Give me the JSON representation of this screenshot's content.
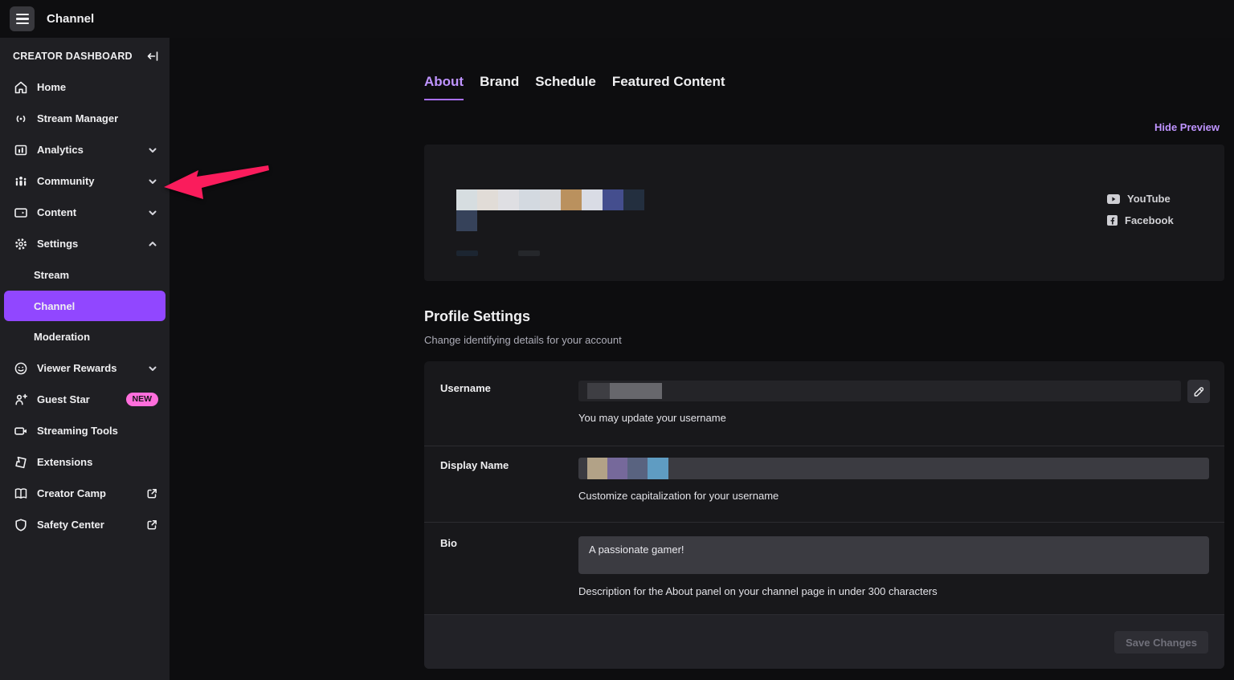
{
  "topbar": {
    "title": "Channel"
  },
  "sidebar": {
    "header": "CREATOR DASHBOARD",
    "items": [
      {
        "label": "Home",
        "icon": "home-icon"
      },
      {
        "label": "Stream Manager",
        "icon": "broadcast-icon"
      },
      {
        "label": "Analytics",
        "icon": "analytics-icon",
        "chevron": "down"
      },
      {
        "label": "Community",
        "icon": "community-icon",
        "chevron": "down"
      },
      {
        "label": "Content",
        "icon": "content-icon",
        "chevron": "down"
      },
      {
        "label": "Settings",
        "icon": "gear-icon",
        "chevron": "up"
      },
      {
        "label": "Viewer Rewards",
        "icon": "smiley-icon",
        "chevron": "down"
      },
      {
        "label": "Guest Star",
        "icon": "person-plus-icon",
        "badge": "NEW"
      },
      {
        "label": "Streaming Tools",
        "icon": "camera-icon"
      },
      {
        "label": "Extensions",
        "icon": "puzzle-icon"
      },
      {
        "label": "Creator Camp",
        "icon": "book-icon",
        "external": true
      },
      {
        "label": "Safety Center",
        "icon": "shield-icon",
        "external": true
      }
    ],
    "settings_children": [
      {
        "label": "Stream"
      },
      {
        "label": "Channel",
        "active": true
      },
      {
        "label": "Moderation"
      }
    ]
  },
  "tabs": {
    "items": [
      {
        "label": "About",
        "active": true
      },
      {
        "label": "Brand"
      },
      {
        "label": "Schedule"
      },
      {
        "label": "Featured Content"
      }
    ]
  },
  "preview": {
    "hide_label": "Hide Preview",
    "banner_swatches": [
      "#d6dde0",
      "#e1dcd7",
      "#dfdfe3",
      "#d3d9e0",
      "#d7d9dd",
      "#ba915e",
      "#d9dce5",
      "#444e8e",
      "#232f3f"
    ],
    "banner_swatch_row2": "#36425a",
    "placeholder_bars": [
      "#1c2531",
      "#25272b"
    ],
    "links": [
      {
        "label": "YouTube",
        "icon": "youtube-icon"
      },
      {
        "label": "Facebook",
        "icon": "facebook-icon"
      }
    ]
  },
  "profile": {
    "title": "Profile Settings",
    "subtitle": "Change identifying details for your account",
    "username": {
      "label": "Username",
      "helper": "You may update your username",
      "redaction": [
        "#3e3e43",
        "#67676c"
      ]
    },
    "display_name": {
      "label": "Display Name",
      "helper": "Customize capitalization for your username",
      "redaction": [
        "#b2a287",
        "#76699b",
        "#596380",
        "#5f9cc2"
      ]
    },
    "bio": {
      "label": "Bio",
      "value": "A passionate gamer!",
      "helper": "Description for the About panel on your channel page in under 300 characters"
    },
    "save_label": "Save Changes"
  },
  "colors": {
    "accent": "#9147ff",
    "tab_active_text": "#bf94ff",
    "new_badge": "#ff6edc",
    "annotation_arrow": "#fa1c5c"
  }
}
